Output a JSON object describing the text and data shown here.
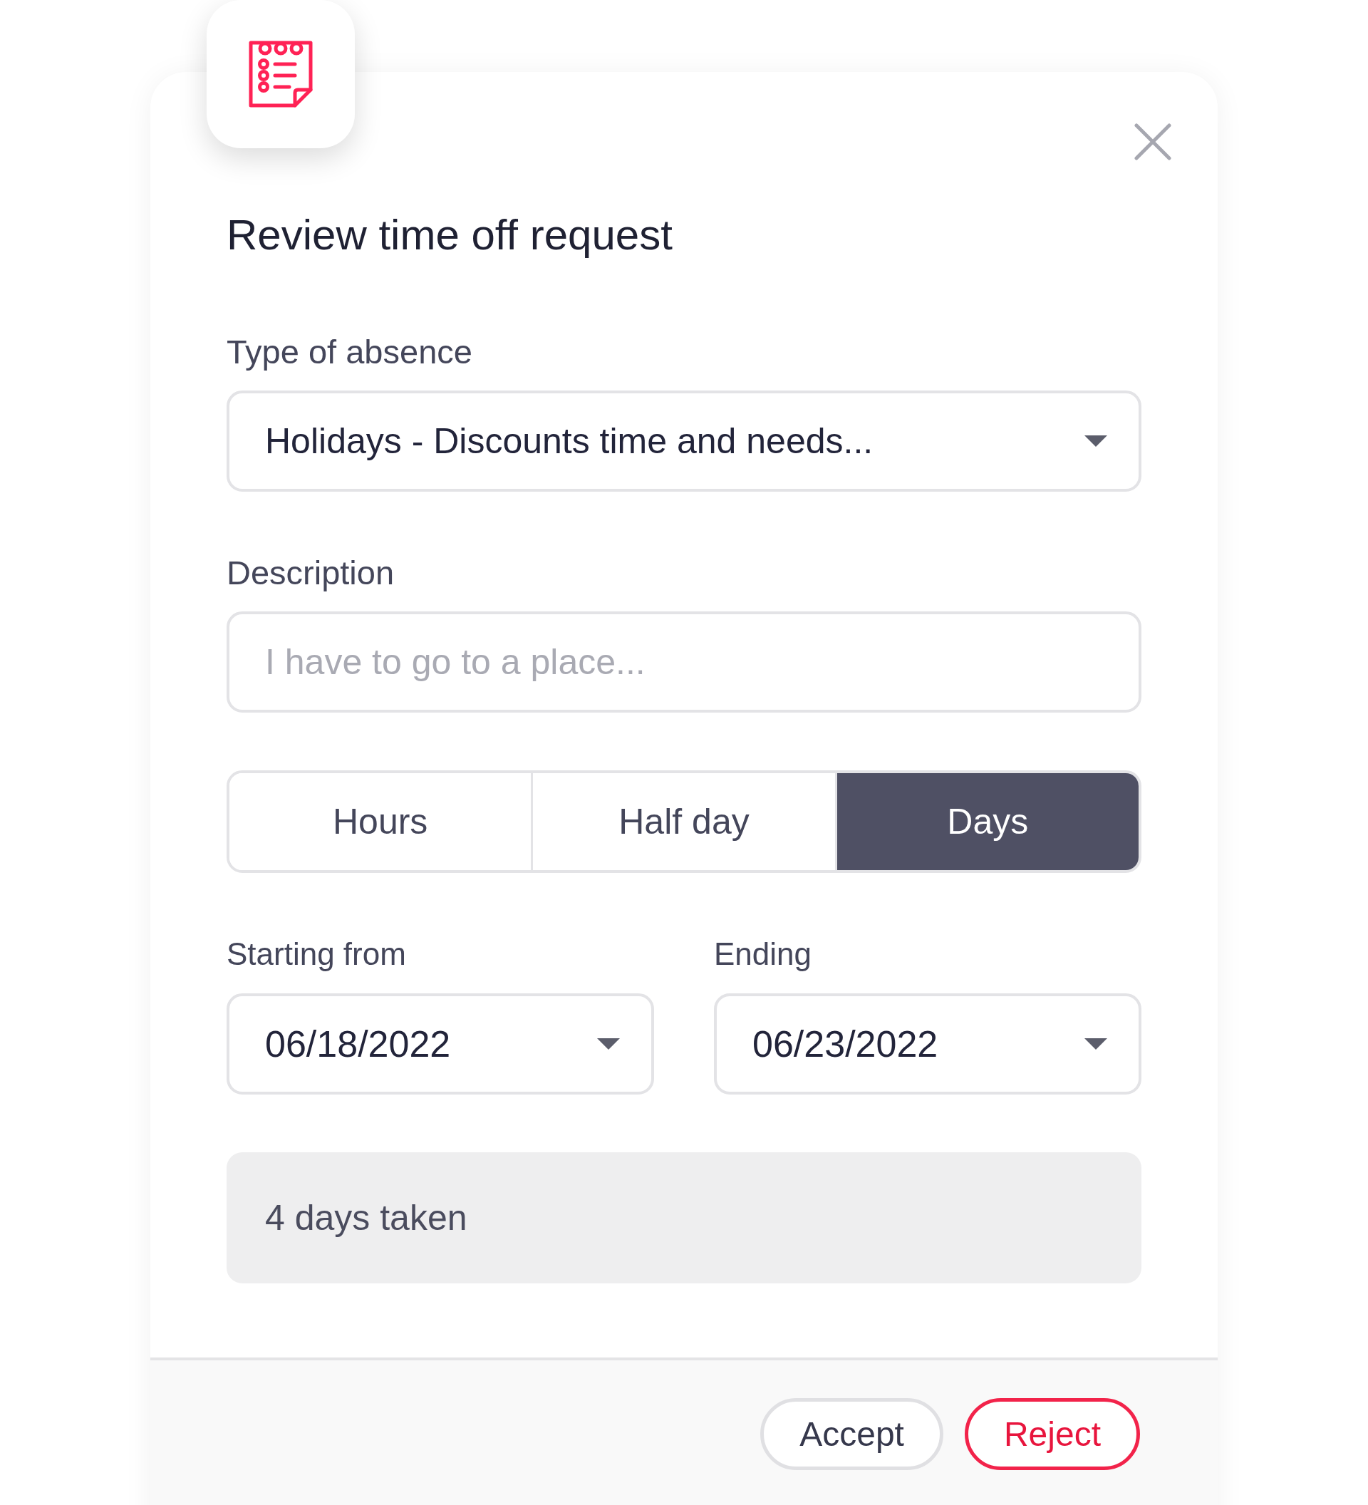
{
  "title": "Review time off request",
  "absence_type": {
    "label": "Type of absence",
    "value": "Holidays - Discounts time and needs..."
  },
  "description": {
    "label": "Description",
    "placeholder": "I have to go to a place..."
  },
  "duration_units": [
    {
      "label": "Hours",
      "selected": false
    },
    {
      "label": "Half day",
      "selected": false
    },
    {
      "label": "Days",
      "selected": true
    }
  ],
  "start": {
    "label": "Starting from",
    "value": "06/18/2022"
  },
  "end": {
    "label": "Ending",
    "value": "06/23/2022"
  },
  "summary": "4 days taken",
  "buttons": [
    {
      "label": "Accept",
      "kind": "secondary"
    },
    {
      "label": "Reject",
      "kind": "danger"
    }
  ]
}
